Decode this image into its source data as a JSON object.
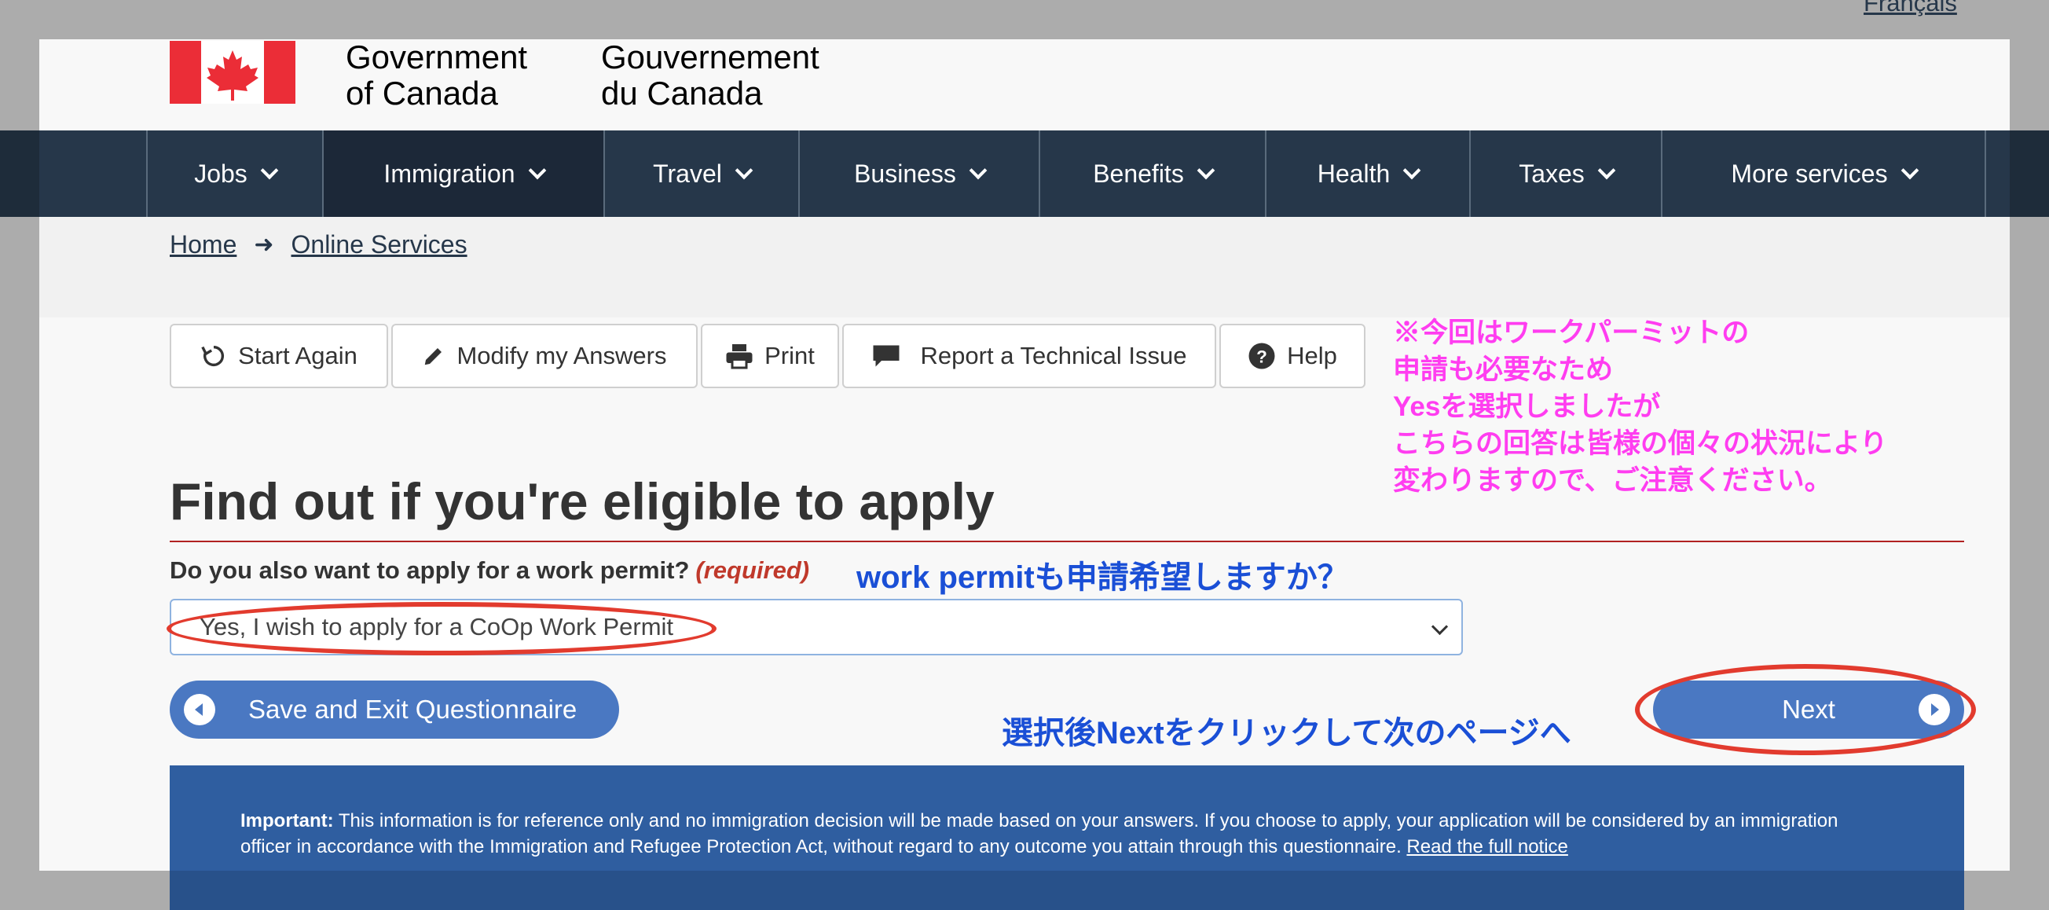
{
  "language_link": "Français",
  "header": {
    "gov_en_line1": "Government",
    "gov_en_line2": "of Canada",
    "gov_fr_line1": "Gouvernement",
    "gov_fr_line2": "du Canada"
  },
  "menu": [
    {
      "label": "Jobs"
    },
    {
      "label": "Immigration"
    },
    {
      "label": "Travel"
    },
    {
      "label": "Business"
    },
    {
      "label": "Benefits"
    },
    {
      "label": "Health"
    },
    {
      "label": "Taxes"
    },
    {
      "label": "More services"
    }
  ],
  "breadcrumb": {
    "home": "Home",
    "online_services": "Online Services"
  },
  "toolbar": {
    "start_again": "Start Again",
    "modify": "Modify my Answers",
    "print": "Print",
    "report": "Report a Technical Issue",
    "help": "Help"
  },
  "annotations": {
    "note_lines": [
      "※今回はワークパーミットの",
      "申請も必要なため",
      "Yesを選択しましたが",
      "こちらの回答は皆様の個々の状況により",
      "変わりますので、ご注意ください。"
    ],
    "question_jp": "work permitも申請希望しますか？",
    "next_jp": "選択後Nextをクリックして次のページへ"
  },
  "page_title": "Find out if you're eligible to apply",
  "question": {
    "text": "Do you also want to apply for a work permit?",
    "required": "(required)"
  },
  "select": {
    "value": "Yes, I wish to apply for a CoOp Work Permit"
  },
  "buttons": {
    "save_exit": "Save and Exit Questionnaire",
    "next": "Next"
  },
  "notice": {
    "label": "Important:",
    "text": "This information is for reference only and no immigration decision will be made based on your answers. If you choose to apply, your application will be considered by an immigration officer in accordance with the Immigration and Refugee Protection Act, without regard to any outcome you attain through this questionnaire.",
    "link": "Read the full notice"
  },
  "colors": {
    "nav": "#26374a",
    "accent_blue": "#4a78c2",
    "notice_bg": "#2f5ea0",
    "annotation_pink": "#ff3df0",
    "annotation_blue": "#1a4fd6",
    "highlight_red": "#e23b2e"
  }
}
